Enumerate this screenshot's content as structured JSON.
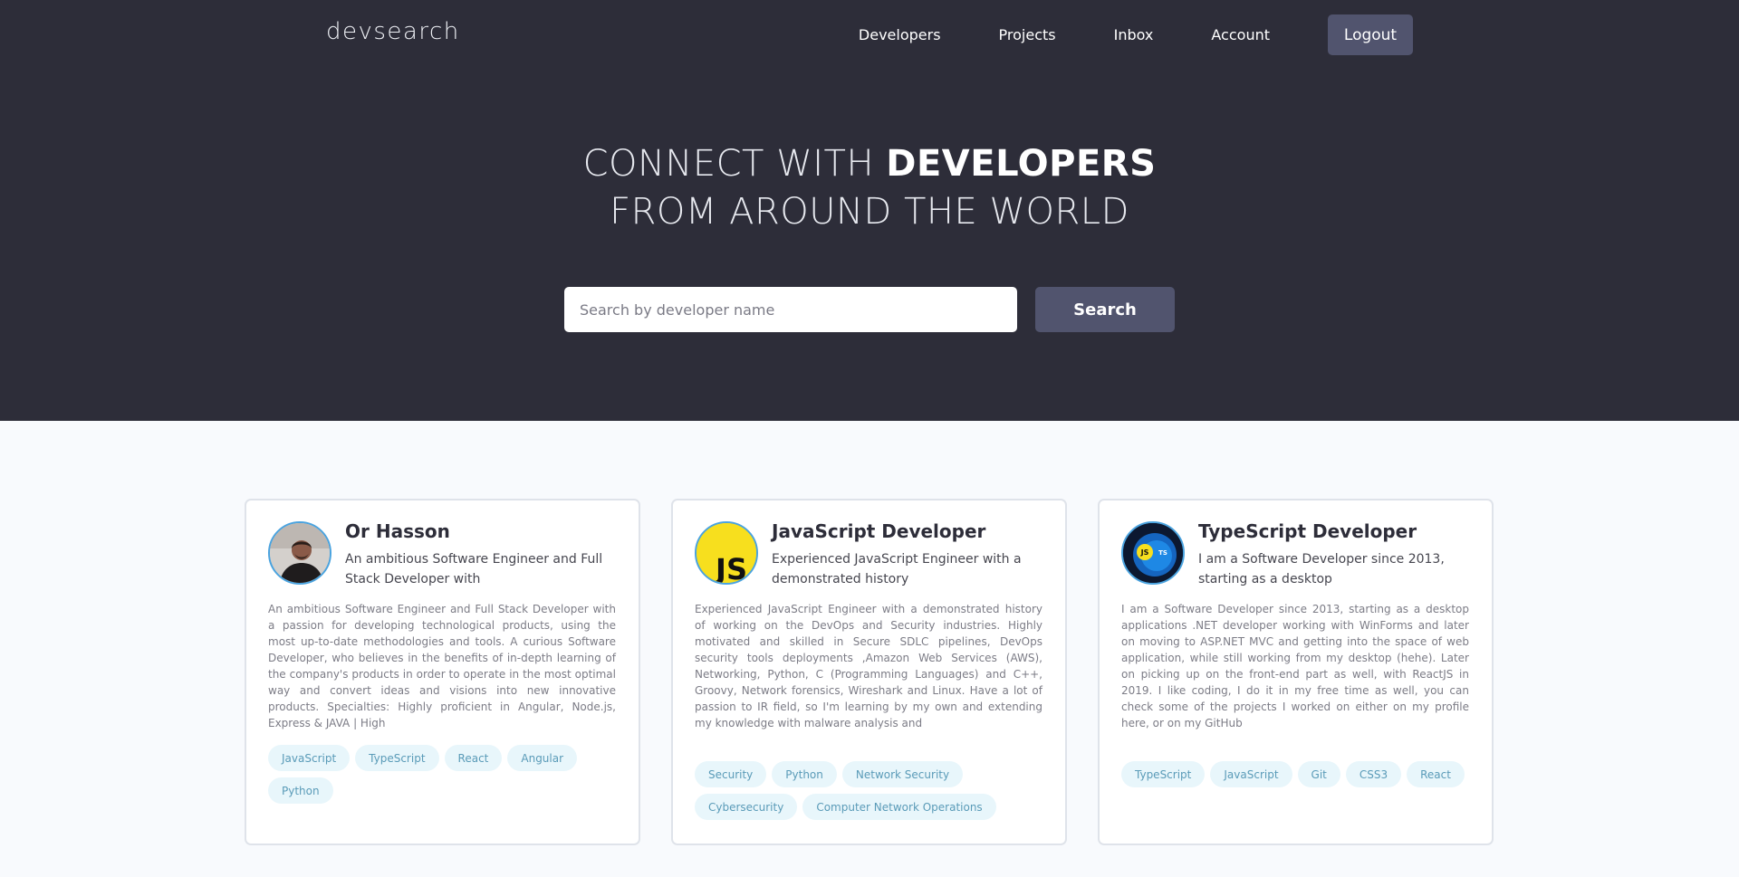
{
  "nav": {
    "logo": "devsearch",
    "links": [
      "Developers",
      "Projects",
      "Inbox",
      "Account"
    ],
    "logout": "Logout"
  },
  "hero": {
    "line1_light": "CONNECT WITH ",
    "line1_bold": "DEVELOPERS",
    "line2": "FROM AROUND THE WORLD"
  },
  "search": {
    "placeholder": "Search by developer name",
    "button": "Search"
  },
  "developers": [
    {
      "name": "Or Hasson",
      "headline": "An ambitious Software Engineer and Full Stack Developer with",
      "bio": "An ambitious Software Engineer and Full Stack Developer with a passion for developing technological products, using the most up-to-date methodologies and tools. A curious Software Developer, who believes in the benefits of in-depth learning of the company's products in order to operate in the most optimal way and convert ideas and visions into new innovative products. Specialties: Highly proficient in Angular, Node.js, Express & JAVA | High",
      "tags": [
        "JavaScript",
        "TypeScript",
        "React",
        "Angular",
        "Python"
      ]
    },
    {
      "name": "JavaScript Developer",
      "headline": "Experienced JavaScript Engineer with a demonstrated history",
      "bio": "Experienced JavaScript Engineer with a demonstrated history of working on the DevOps and Security industries. Highly motivated and skilled in Secure SDLC pipelines, DevOps security tools deployments ,Amazon Web Services (AWS), Networking, Python, C (Programming Languages) and C++, Groovy, Network forensics, Wireshark and Linux. Have a lot of passion to IR field, so I'm learning by my own and extending my knowledge with malware analysis and",
      "tags": [
        "Security",
        "Python",
        "Network Security",
        "Cybersecurity",
        "Computer Network Operations"
      ]
    },
    {
      "name": "TypeScript Developer",
      "headline": "I am a Software Developer since 2013, starting as a desktop",
      "bio": "I am a Software Developer since 2013, starting as a desktop applications .NET developer working with WinForms and later on moving to ASP.NET MVC and getting into the space of web application, while still working from my desktop (hehe). Later on picking up on the front-end part as well, with ReactJS in 2019. I like coding, I do it in my free time as well, you can check some of the projects I worked on either on my profile here, or on my GitHub",
      "tags": [
        "TypeScript",
        "JavaScript",
        "Git",
        "CSS3",
        "React"
      ]
    }
  ],
  "avatar_badges": {
    "js": "JS",
    "ts_left": "JS",
    "ts_right": "TS"
  },
  "colors": {
    "header_bg": "#2d2d39",
    "button_bg": "#51546e",
    "page_bg": "#f8fafd",
    "tag_bg": "#e8f6fb",
    "tag_text": "#5a9bb8",
    "js_yellow": "#f7df1e"
  }
}
